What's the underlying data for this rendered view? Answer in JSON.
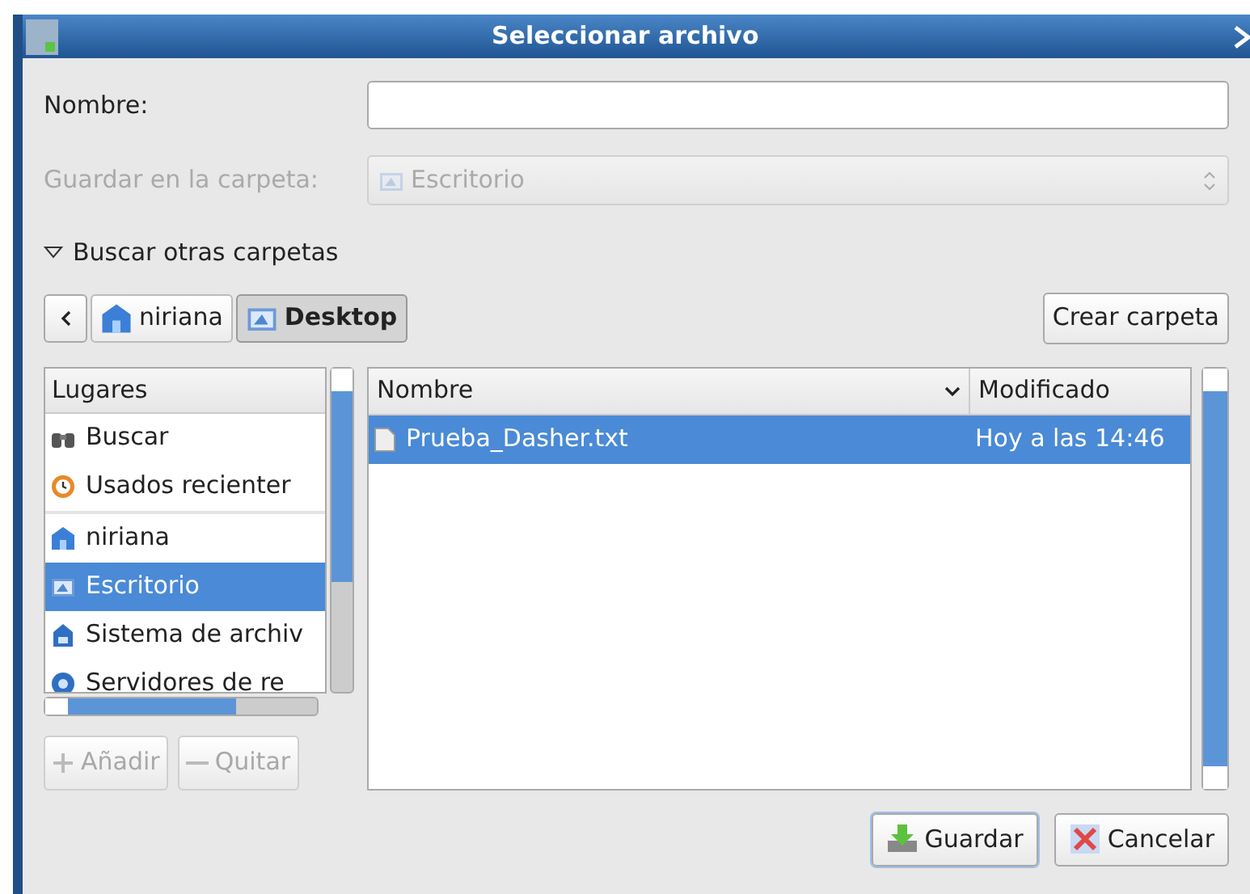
{
  "window": {
    "title": "Seleccionar archivo"
  },
  "name_field": {
    "label": "Nombre:"
  },
  "folder_combo": {
    "label": "Guardar en la carpeta:",
    "value": "Escritorio",
    "disabled": true
  },
  "browse_toggle": {
    "label": "Buscar otras carpetas",
    "expanded": true
  },
  "path_bar": {
    "buttons": [
      {
        "label": "niriana",
        "kind": "home",
        "selected": false
      },
      {
        "label": "Desktop",
        "kind": "desktop",
        "selected": true
      }
    ]
  },
  "create_folder_button": "Crear carpeta",
  "places": {
    "header": "Lugares",
    "sections": [
      {
        "items": [
          {
            "label": "Buscar",
            "kind": "search",
            "selected": false
          },
          {
            "label": "Usados recienter",
            "kind": "recent",
            "selected": false
          }
        ]
      },
      {
        "items": [
          {
            "label": "niriana",
            "kind": "home",
            "selected": false
          },
          {
            "label": "Escritorio",
            "kind": "desktop",
            "selected": true
          },
          {
            "label": "Sistema de archiv",
            "kind": "drive",
            "selected": false
          },
          {
            "label": "Servidores de re",
            "kind": "network",
            "selected": false
          }
        ]
      }
    ],
    "add_button": {
      "label": "Añadir",
      "disabled": true
    },
    "remove_button": {
      "label": "Quitar",
      "disabled": true
    }
  },
  "files": {
    "columns": [
      "Nombre",
      "Modificado"
    ],
    "rows": [
      {
        "name": "Prueba_Dasher.txt",
        "modified": "Hoy a las 14:46",
        "selected": true
      }
    ]
  },
  "buttons": [
    {
      "label": "Guardar",
      "kind": "save",
      "default": true
    },
    {
      "label": "Cancelar",
      "kind": "cancel",
      "default": false
    }
  ]
}
